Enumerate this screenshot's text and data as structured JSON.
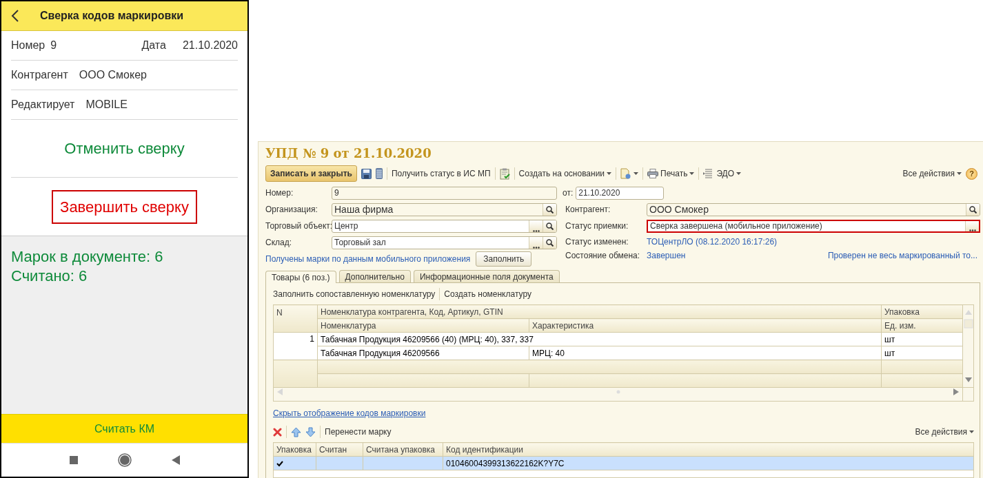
{
  "mobile": {
    "title": "Сверка кодов маркировки",
    "number": {
      "label": "Номер",
      "value": "9"
    },
    "date": {
      "label": "Дата",
      "value": "21.10.2020"
    },
    "fields": [
      {
        "label": "Контрагент",
        "value": "ООО Смокер"
      },
      {
        "label": "Редактирует",
        "value": "MOBILE"
      }
    ],
    "actions": [
      {
        "label": "Отменить сверку",
        "kind": "plain"
      },
      {
        "label": "Завершить сверку",
        "kind": "outlined"
      }
    ],
    "summary": [
      "Марок в документе: 6",
      "Считано: 6"
    ],
    "scan_button": "Считать КМ"
  },
  "desktop": {
    "title": "УПД № 9 от 21.10.2020",
    "toolbar": {
      "save_close": "Записать и закрыть",
      "get_status": "Получить статус в ИС МП",
      "create_based": "Создать на основании",
      "print": "Печать",
      "edo": "ЭДО",
      "all_actions": "Все действия",
      "help": "?"
    },
    "number": {
      "label": "Номер:",
      "value": "9"
    },
    "date": {
      "label": "от:",
      "value": "21.10.2020"
    },
    "left_fields": [
      {
        "label": "Организация:",
        "value": "Наша фирма",
        "kind": "ref"
      },
      {
        "label": "Торговый объект:",
        "value": "Центр",
        "kind": "choice"
      },
      {
        "label": "Склад:",
        "value": "Торговый зал",
        "kind": "choice"
      }
    ],
    "fill_note": {
      "link": "Получены марки по данным мобильного приложения",
      "button": "Заполнить"
    },
    "right_fields": [
      {
        "label": "Контрагент:",
        "value": "ООО Смокер",
        "kind": "ref",
        "highlighted": false
      },
      {
        "label": "Статус приемки:",
        "value": "Сверка завершена (мобильное приложение)",
        "kind": "status",
        "highlighted": true
      }
    ],
    "status_changed": {
      "label": "Статус изменен:",
      "link": "ТОЦентрЛО (08.12.2020 16:17:26)"
    },
    "exchange": {
      "label": "Состояние обмена:",
      "link": "Завершен"
    },
    "check_warning": "Проверен не весь маркированный то...",
    "tabs": [
      {
        "label": "Товары (6 поз.)",
        "selected": true
      },
      {
        "label": "Дополнительно",
        "selected": false
      },
      {
        "label": "Информационные поля документа",
        "selected": false
      }
    ],
    "goods_toolbar": [
      "Заполнить сопоставленную номенклатуру",
      "Создать номенклатуру"
    ],
    "goods": {
      "header_top": [
        "N",
        "Номенклатура контрагента, Код, Артикул, GTIN",
        "Упаковка"
      ],
      "header_bottom": [
        "Номенклатура",
        "Характеристика",
        "Ед. изм."
      ],
      "rows": [
        {
          "n": "1",
          "vendor_item": "Табачная Продукция 46209566 (40) (МРЦ: 40), 337, 337",
          "unit_pack": "шт",
          "item": "Табачная Продукция 46209566",
          "characteristic": "МРЦ: 40",
          "unit": "шт"
        }
      ]
    },
    "toggle_codes_link": "Скрыть отображение кодов маркировки",
    "codes_toolbar": {
      "move": "Перенести марку",
      "all_actions": "Все действия"
    },
    "codes": {
      "columns": [
        "Упаковка",
        "Считан",
        "Считана упаковка",
        "Код идентификации"
      ],
      "rows": [
        {
          "packed": true,
          "scanned": false,
          "scanned_pack": false,
          "code": "01046004399313622162K?Y7C",
          "selected": true
        }
      ]
    }
  }
}
